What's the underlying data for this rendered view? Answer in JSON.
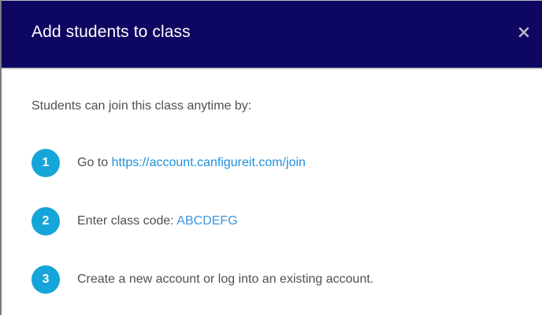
{
  "header": {
    "title": "Add students to class",
    "close_icon": "close-icon"
  },
  "colors": {
    "header_bg": "#0e0761",
    "badge": "#15a5d8",
    "link": "#1e8fdb"
  },
  "body": {
    "intro": "Students can join this class anytime by:",
    "steps": [
      {
        "number": "1",
        "prefix": "Go to ",
        "link": "https://account.canfigureit.com/join"
      },
      {
        "number": "2",
        "prefix": "Enter class code: ",
        "code": "ABCDEFG"
      },
      {
        "number": "3",
        "text": "Create a new account or log into an existing account."
      }
    ]
  }
}
